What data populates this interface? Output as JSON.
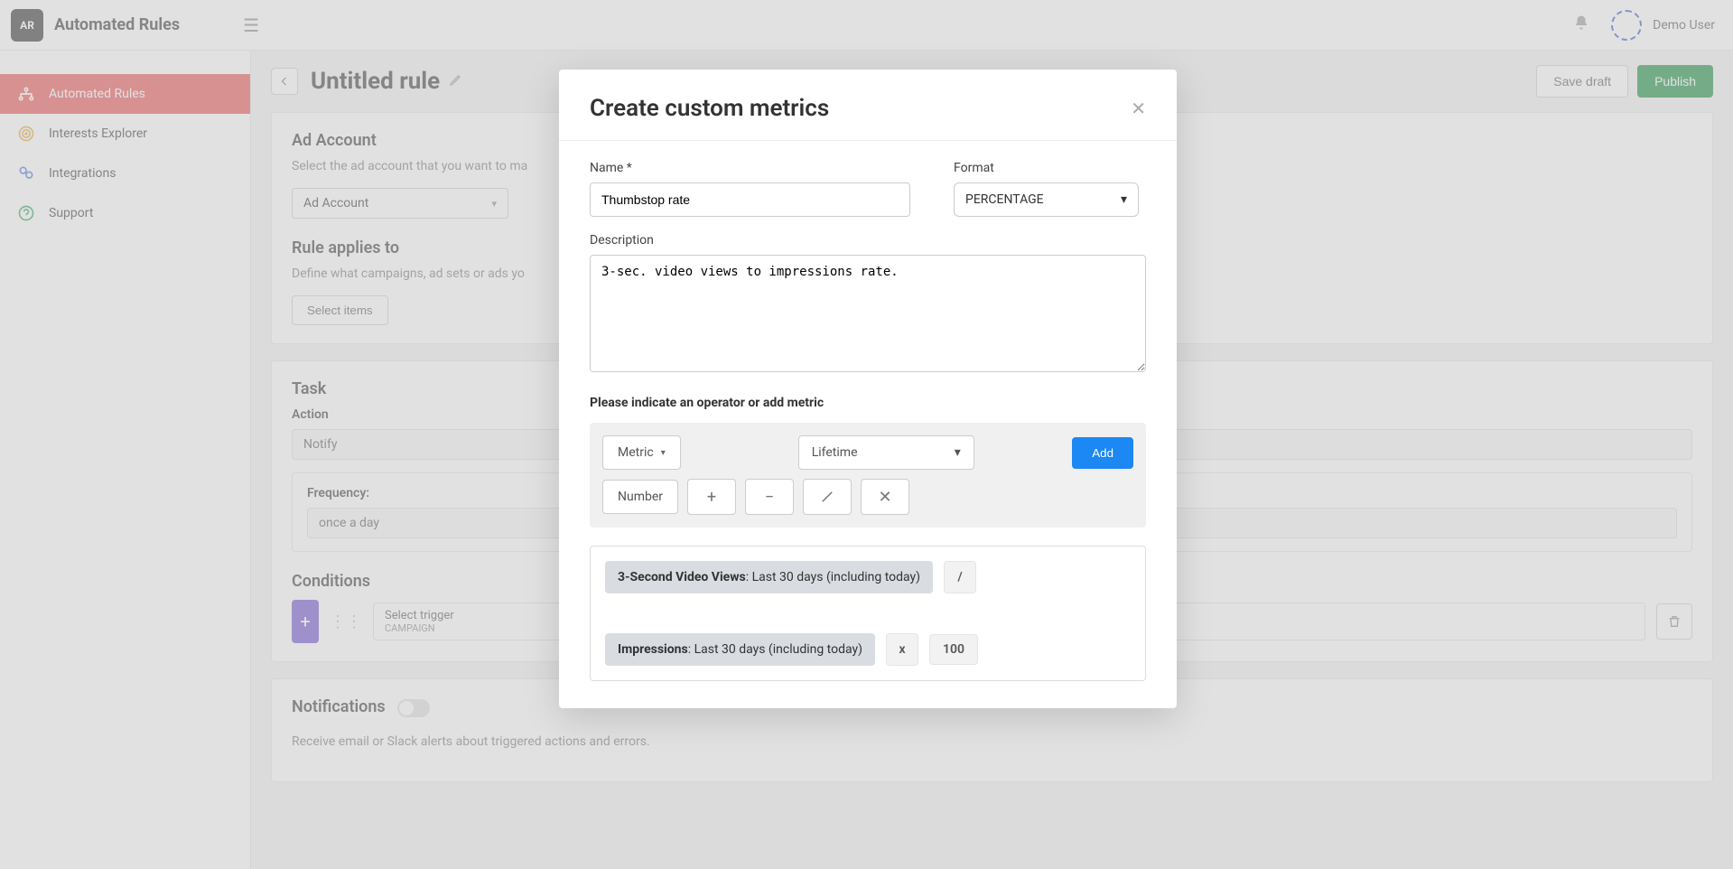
{
  "app": {
    "logo_text": "AR",
    "name": "Automated Rules",
    "user_name": "Demo User"
  },
  "sidebar": {
    "items": [
      {
        "label": "Automated Rules"
      },
      {
        "label": "Interests Explorer"
      },
      {
        "label": "Integrations"
      },
      {
        "label": "Support"
      }
    ]
  },
  "page": {
    "title": "Untitled rule",
    "save_draft": "Save draft",
    "publish": "Publish"
  },
  "ad_account": {
    "heading": "Ad Account",
    "hint": "Select the ad account that you want to ma",
    "selected": "Ad Account"
  },
  "applies": {
    "heading": "Rule applies to",
    "hint": "Define what campaigns, ad sets or ads yo",
    "select_items": "Select items"
  },
  "task": {
    "heading": "Task",
    "action_label": "Action",
    "action_value": "Notify",
    "frequency_label": "Frequency:",
    "frequency_value": "once a day"
  },
  "conditions": {
    "heading": "Conditions",
    "trigger_label": "Select trigger",
    "trigger_sub": "CAMPAIGN"
  },
  "notifications": {
    "heading": "Notifications",
    "hint": "Receive email or Slack alerts about triggered actions and errors."
  },
  "modal": {
    "title": "Create custom metrics",
    "name_label": "Name",
    "name_value": "Thumbstop rate",
    "format_label": "Format",
    "format_value": "PERCENTAGE",
    "description_label": "Description",
    "description_value": "3-sec. video views to impressions rate.",
    "builder_label": "Please indicate an operator or add metric",
    "metric_btn": "Metric",
    "lifetime_btn": "Lifetime",
    "add_btn": "Add",
    "number_btn": "Number",
    "formula": {
      "token1_name": "3-Second Video Views",
      "token1_range": "Last 30 days (including today)",
      "op1": "/",
      "token2_name": "Impressions",
      "token2_range": "Last 30 days (including today)",
      "op2": "x",
      "number": "100"
    }
  }
}
